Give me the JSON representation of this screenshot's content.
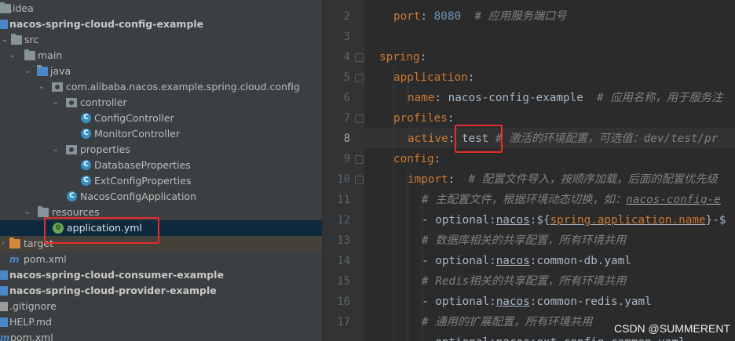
{
  "tree": {
    "rows": [
      {
        "label": ".idea"
      },
      {
        "label": "nacos-spring-cloud-config-example"
      },
      {
        "label": "src"
      },
      {
        "label": "main"
      },
      {
        "label": "java"
      },
      {
        "label": "com.alibaba.nacos.example.spring.cloud.config"
      },
      {
        "label": "controller"
      },
      {
        "label": "ConfigController"
      },
      {
        "label": "MonitorController"
      },
      {
        "label": "properties"
      },
      {
        "label": "DatabaseProperties"
      },
      {
        "label": "ExtConfigProperties"
      },
      {
        "label": "NacosConfigApplication"
      },
      {
        "label": "resources"
      },
      {
        "label": "application.yml"
      },
      {
        "label": "target"
      },
      {
        "label": "pom.xml"
      },
      {
        "label": "nacos-spring-cloud-consumer-example"
      },
      {
        "label": "nacos-spring-cloud-provider-example"
      },
      {
        "label": ".gitignore"
      },
      {
        "label": "HELP.md"
      },
      {
        "label": "pom.xml"
      }
    ],
    "class_icon_letter": "C"
  },
  "editor": {
    "line_numbers": [
      "2",
      "3",
      "4",
      "5",
      "6",
      "7",
      "8",
      "9",
      "10",
      "11",
      "12",
      "13",
      "14",
      "15",
      "16",
      "17"
    ],
    "current_line": "8",
    "lines": [
      {
        "key": "port",
        "colon": ":",
        "value": "8080",
        "comment": "# 应用服务端口号"
      },
      {},
      {
        "key": "spring",
        "colon": ":"
      },
      {
        "key": "application",
        "colon": ":"
      },
      {
        "key": "name",
        "colon": ":",
        "value": "nacos-config-example",
        "comment": "# 应用名称，用于服务注"
      },
      {
        "key": "profiles",
        "colon": ":"
      },
      {
        "key": "active",
        "colon": ":",
        "value": "test",
        "comment": "# 激活的环境配置，可选值：dev/test/pr"
      },
      {
        "key": "config",
        "colon": ":"
      },
      {
        "key": "import",
        "colon": ":",
        "comment": "# 配置文件导入，按顺序加载，后面的配置优先级"
      },
      {
        "comment_a": "# 主配置文件，根据环境动态切换，如：",
        "comment_b": "nacos-config-e"
      },
      {
        "dash": "-",
        "optional": "optional:",
        "nacos": "nacos",
        "colon": ":",
        "placeholder_open": "${",
        "placeholder_name": "spring.application.name",
        "placeholder_close": "}",
        "tail": "-$"
      },
      {
        "comment": "# 数据库相关的共享配置，所有环境共用"
      },
      {
        "dash": "-",
        "optional": "optional:",
        "nacos": "nacos",
        "colon": ":",
        "file": "common-db.yaml"
      },
      {
        "comment": "# Redis相关的共享配置，所有环境共用"
      },
      {
        "dash": "-",
        "optional": "optional:",
        "nacos": "nacos",
        "colon": ":",
        "file": "common-redis.yaml"
      },
      {
        "comment": "# 通用的扩展配置，所有环境共用"
      },
      {
        "partial": "- optional:nacos:ext-config-common.yaml"
      }
    ]
  },
  "watermark": "CSDN @SUMMERENT",
  "colors": {
    "highlight_box": "#e52d2d",
    "yaml_key": "#cc7832",
    "number": "#6897bb",
    "comment": "#808080"
  }
}
